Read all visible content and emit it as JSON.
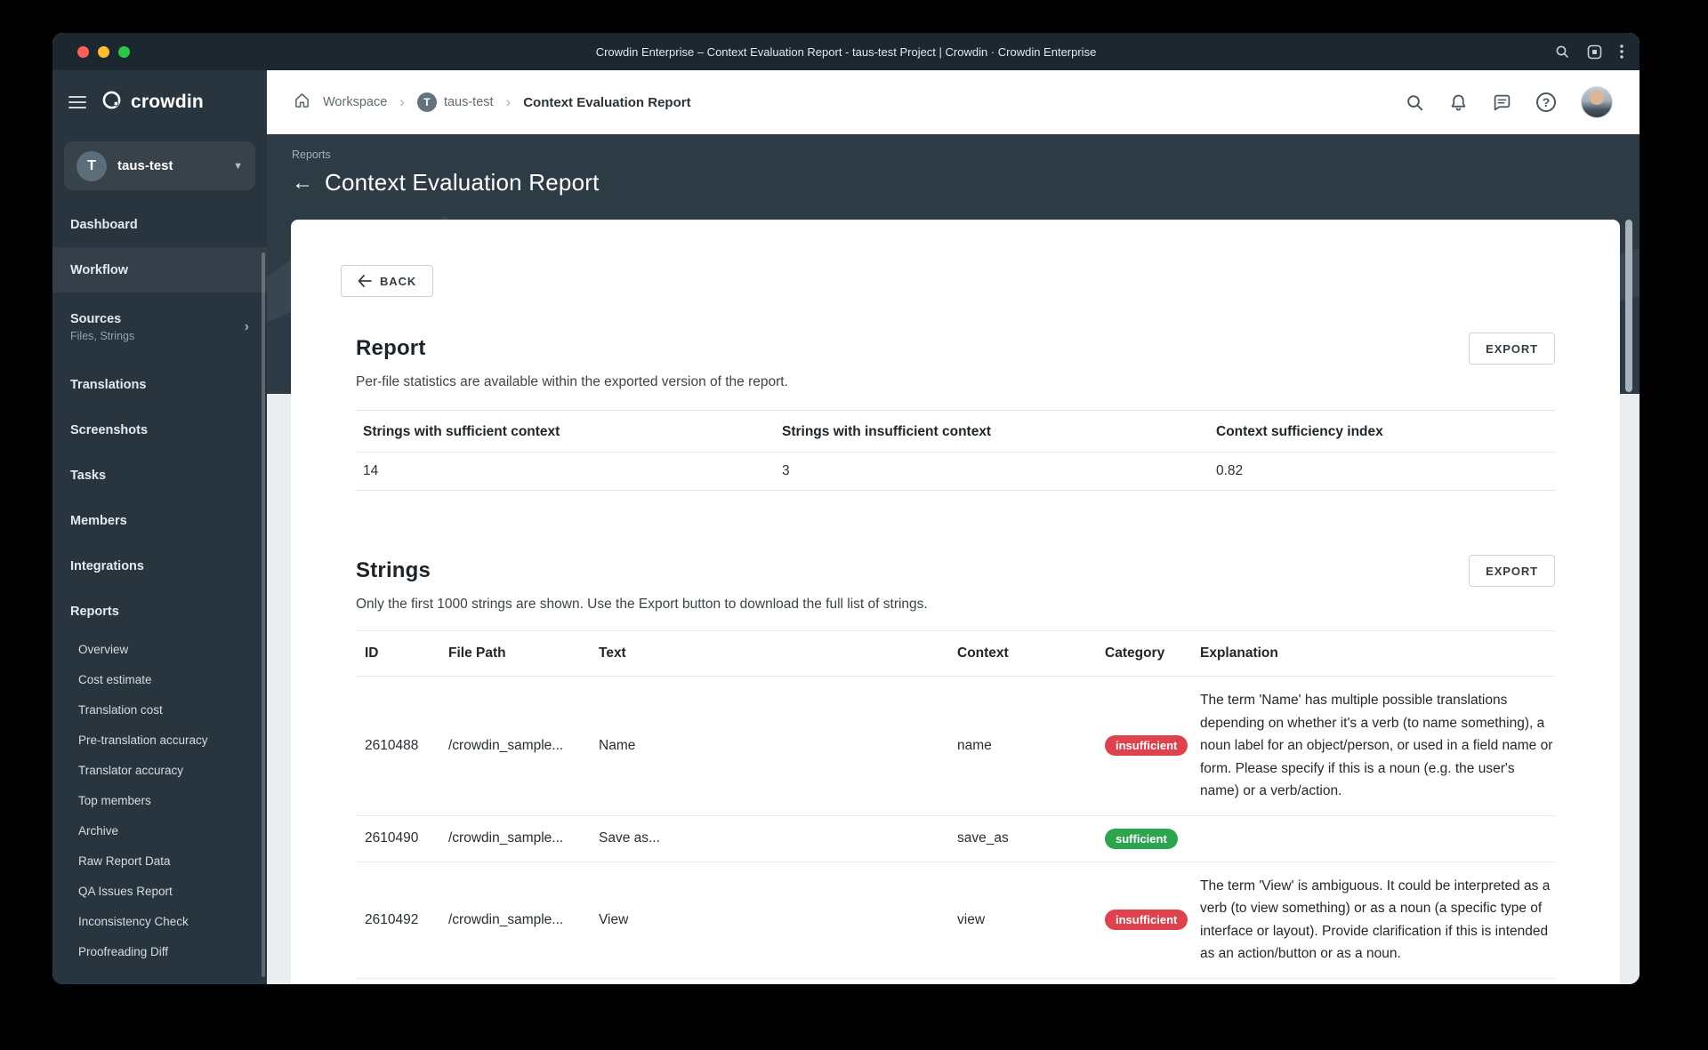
{
  "window": {
    "title": "Crowdin Enterprise – Context Evaluation Report - taus-test Project | Crowdin · Crowdin Enterprise"
  },
  "sidebar": {
    "logo_word": "crowdin",
    "project": {
      "initial": "T",
      "name": "taus-test"
    },
    "items": [
      {
        "label": "Dashboard"
      },
      {
        "label": "Workflow"
      },
      {
        "label": "Sources",
        "subtitle": "Files, Strings"
      },
      {
        "label": "Translations"
      },
      {
        "label": "Screenshots"
      },
      {
        "label": "Tasks"
      },
      {
        "label": "Members"
      },
      {
        "label": "Integrations"
      },
      {
        "label": "Reports"
      }
    ],
    "report_items": [
      "Overview",
      "Cost estimate",
      "Translation cost",
      "Pre-translation accuracy",
      "Translator accuracy",
      "Top members",
      "Archive",
      "Raw Report Data",
      "QA Issues Report",
      "Inconsistency Check",
      "Proofreading Diff"
    ]
  },
  "breadcrumb": {
    "workspace": "Workspace",
    "project_initial": "T",
    "project": "taus-test",
    "page": "Context Evaluation Report"
  },
  "hero": {
    "eyebrow": "Reports",
    "title": "Context Evaluation Report"
  },
  "report": {
    "back_label": "BACK",
    "title": "Report",
    "subtitle": "Per-file statistics are available within the exported version of the report.",
    "export_label": "EXPORT",
    "stats": {
      "headers": [
        "Strings with sufficient context",
        "Strings with insufficient context",
        "Context sufficiency index"
      ],
      "values": [
        "14",
        "3",
        "0.82"
      ]
    }
  },
  "strings": {
    "title": "Strings",
    "subtitle": "Only the first 1000 strings are shown. Use the Export button to download the full list of strings.",
    "export_label": "EXPORT",
    "headers": [
      "ID",
      "File Path",
      "Text",
      "Context",
      "Category",
      "Explanation"
    ],
    "rows": [
      {
        "id": "2610488",
        "file_path": "/crowdin_sample...",
        "text": "Name",
        "context": "name",
        "category": "insufficient",
        "explanation": "The term 'Name' has multiple possible translations depending on whether it's a verb (to name something), a noun label for an object/person, or used in a field name or form. Please specify if this is a noun (e.g. the user's name) or a verb/action."
      },
      {
        "id": "2610490",
        "file_path": "/crowdin_sample...",
        "text": "Save as...",
        "context": "save_as",
        "category": "sufficient",
        "explanation": ""
      },
      {
        "id": "2610492",
        "file_path": "/crowdin_sample...",
        "text": "View",
        "context": "view",
        "category": "insufficient",
        "explanation": "The term 'View' is ambiguous. It could be interpreted as a verb (to view something) or as a noun (a specific type of interface or layout). Provide clarification if this is intended as an action/button or as a noun."
      }
    ]
  },
  "colors": {
    "insufficient": "#e0424d",
    "sufficient": "#2da44e"
  }
}
